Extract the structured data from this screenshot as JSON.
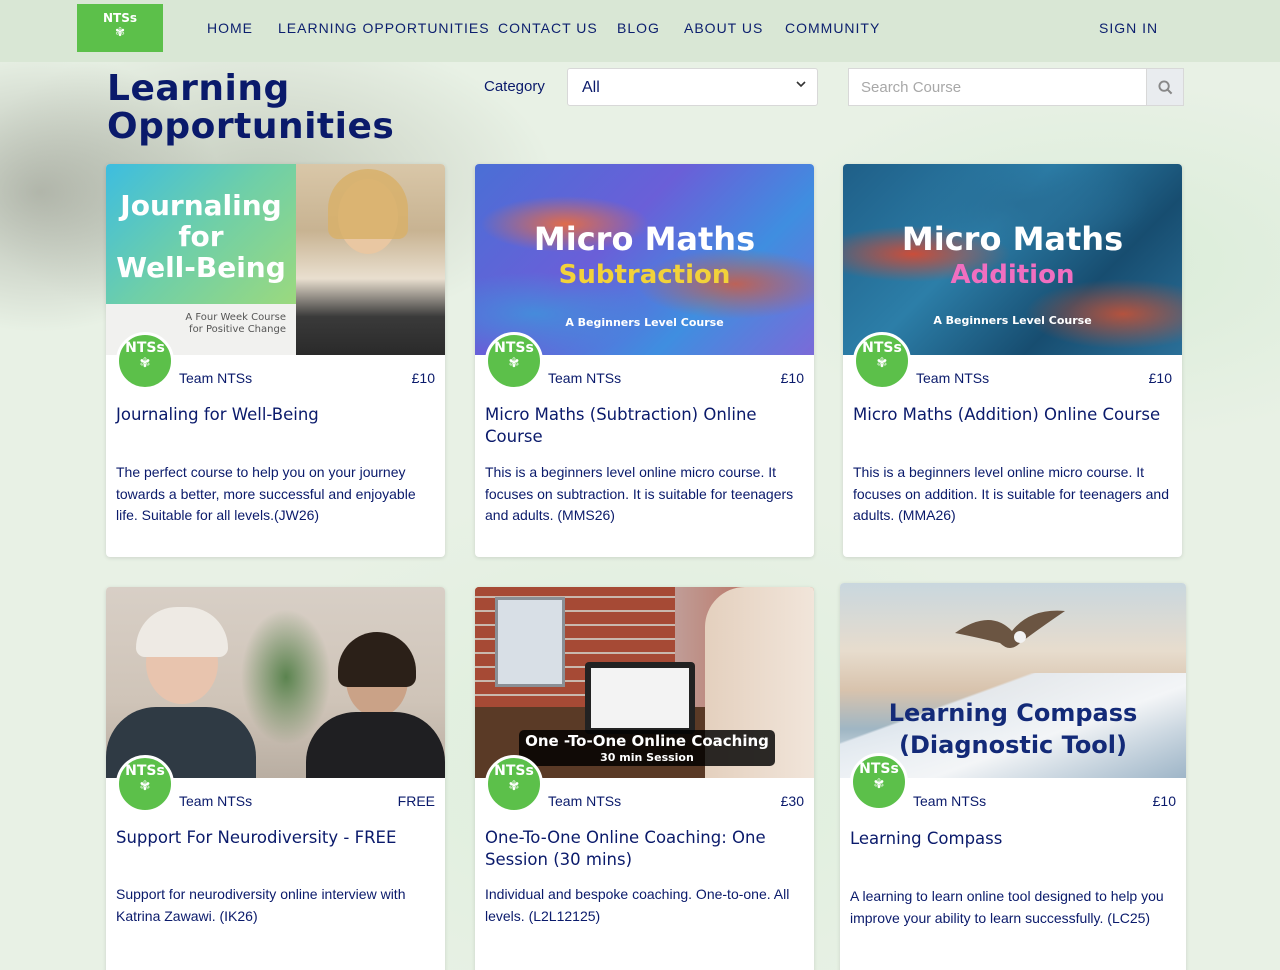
{
  "brand": {
    "logo_text": "NTSs",
    "logo_glyph": "✾"
  },
  "nav": {
    "items": [
      "HOME",
      "LEARNING OPPORTUNITIES",
      "CONTACT US",
      "BLOG",
      "ABOUT US",
      "COMMUNITY"
    ],
    "sign_in": "SIGN IN"
  },
  "page": {
    "title": "Learning Opportunities"
  },
  "filters": {
    "category_label": "Category",
    "category_value": "All",
    "search_placeholder": "Search Course"
  },
  "courses": [
    {
      "image": {
        "line1": "Journaling",
        "line2": "for",
        "line3": "Well-Being",
        "sub1": "A Four Week Course",
        "sub2": "for Positive Change"
      },
      "author": "Team NTSs",
      "price": "£10",
      "title": "Journaling for Well-Being",
      "description": "The perfect course to help you on your journey towards a better, more successful and enjoyable life. Suitable for all levels.(JW26)"
    },
    {
      "image": {
        "line1": "Micro Maths",
        "line2": "Subtraction",
        "sub": "A Beginners Level Course"
      },
      "author": "Team NTSs",
      "price": "£10",
      "title": "Micro Maths (Subtraction) Online Course",
      "description": "This is a beginners level online micro course. It focuses on subtraction. It is suitable for teenagers and adults. (MMS26)"
    },
    {
      "image": {
        "line1": "Micro Maths",
        "line2": "Addition",
        "sub": "A Beginners Level Course"
      },
      "author": "Team NTSs",
      "price": "£10",
      "title": "Micro Maths (Addition) Online Course",
      "description": "This is a beginners level online micro course. It focuses on addition. It is suitable for teenagers and adults. (MMA26)"
    },
    {
      "image": {},
      "author": "Team NTSs",
      "price": "FREE",
      "title": "Support For Neurodiversity - FREE",
      "description": "Support for neurodiversity online interview with Katrina Zawawi. (IK26)"
    },
    {
      "image": {
        "line1": "One -To-One Online Coaching",
        "sub": "30 min Session"
      },
      "author": "Team NTSs",
      "price": "£30",
      "title": "One-To-One Online Coaching: One Session (30 mins)",
      "description": "Individual and bespoke coaching. One-to-one. All levels. (L2L12125)"
    },
    {
      "image": {
        "line1": "Learning Compass",
        "line2": "(Diagnostic Tool)"
      },
      "author": "Team NTSs",
      "price": "£10",
      "title": "Learning Compass",
      "description": "A learning to learn online tool designed to help you improve your ability to learn successfully. (LC25)"
    }
  ],
  "colors": {
    "brand_green": "#5cc04a",
    "navy": "#0a1a6b",
    "nav_bg": "#d9e7d5"
  }
}
